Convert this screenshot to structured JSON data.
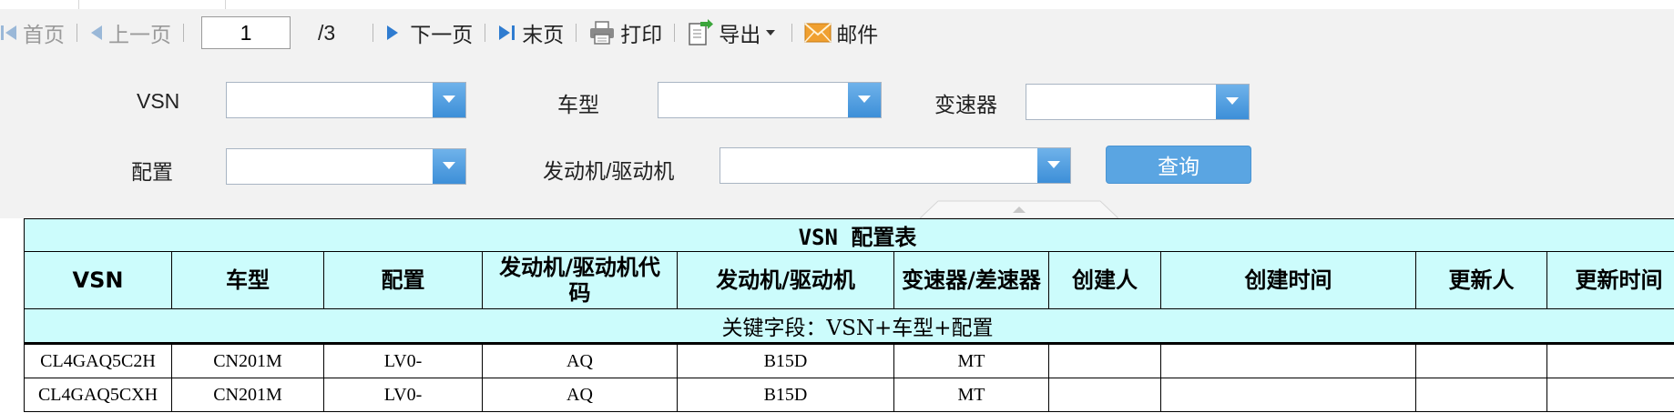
{
  "toolbar": {
    "first_label": "首页",
    "prev_label": "上一页",
    "page_value": "1",
    "page_total": "/3",
    "next_label": "下一页",
    "last_label": "末页",
    "print_label": "打印",
    "export_label": "导出",
    "mail_label": "邮件"
  },
  "filters": {
    "vsn_label": "VSN",
    "model_label": "车型",
    "gearbox_label": "变速器",
    "config_label": "配置",
    "engine_label": "发动机/驱动机",
    "query_label": "查询",
    "vsn_value": "",
    "model_value": "",
    "gearbox_value": "",
    "config_value": "",
    "engine_value": ""
  },
  "table": {
    "title": "VSN 配置表",
    "headers": [
      "VSN",
      "车型",
      "配置",
      "发动机/驱动机代码",
      "发动机/驱动机",
      "变速器/差速器",
      "创建人",
      "创建时间",
      "更新人",
      "更新时间"
    ],
    "key_note": "关键字段：VSN+车型+配置",
    "rows": [
      [
        "CL4GAQ5C2H",
        "CN201M",
        "LV0-",
        "AQ",
        "B15D",
        "MT",
        "",
        "",
        "",
        ""
      ],
      [
        "CL4GAQ5CXH",
        "CN201M",
        "LV0-",
        "AQ",
        "B15D",
        "MT",
        "",
        "",
        "",
        ""
      ]
    ]
  },
  "colors": {
    "toolbar_bg": "#f2f2f2",
    "icon_blue": "#2f7cd0",
    "button_blue": "#5aa5e2",
    "table_header_bg": "#ccfcfc",
    "mail_orange": "#f0a030"
  },
  "icons": [
    "first-page-icon",
    "prev-page-icon",
    "next-page-icon",
    "last-page-icon",
    "printer-icon",
    "export-icon",
    "caret-down-icon",
    "mail-icon",
    "dropdown-arrow-icon"
  ]
}
